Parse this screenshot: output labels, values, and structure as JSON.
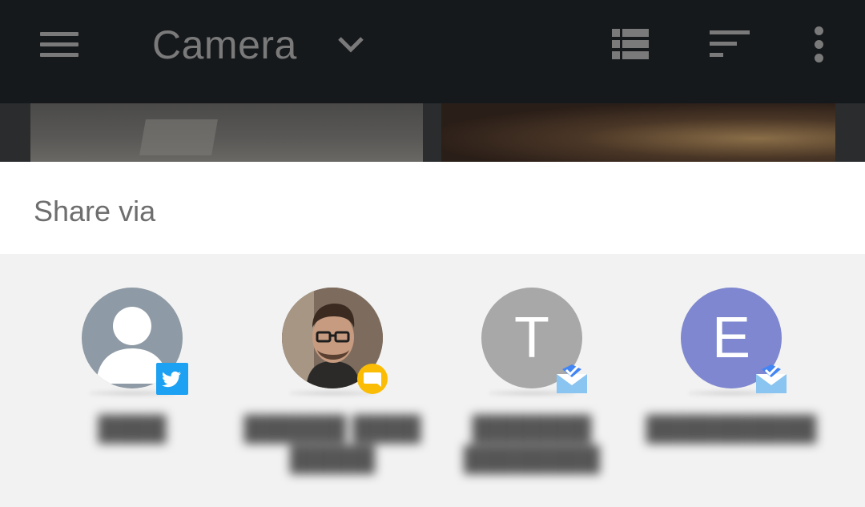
{
  "appbar": {
    "title": "Camera",
    "icons": [
      "menu-icon",
      "chevron-down-icon",
      "list-view-icon",
      "sort-icon",
      "more-vert-icon"
    ]
  },
  "share_sheet": {
    "title": "Share via",
    "targets": [
      {
        "avatar_type": "person-silhouette",
        "avatar_color": "#8e9aa5",
        "app_badge": "twitter-icon",
        "badge_color": "#1da1f2"
      },
      {
        "avatar_type": "photo",
        "app_badge": "allo-icon",
        "badge_color": "#fbbc05"
      },
      {
        "avatar_letter": "T",
        "avatar_color": "#a8a8a8",
        "app_badge": "inbox-icon",
        "badge_color": "#4285f4"
      },
      {
        "avatar_letter": "E",
        "avatar_color": "#7e87cf",
        "app_badge": "inbox-icon",
        "badge_color": "#4285f4"
      }
    ]
  }
}
